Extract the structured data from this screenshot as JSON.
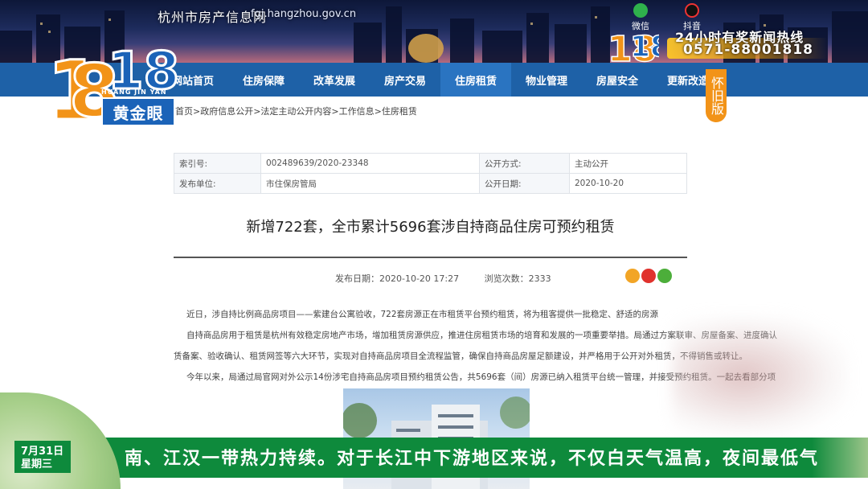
{
  "header": {
    "site_title": "杭州市房产信息网",
    "site_domain": "fgj.hangzhou.gov.cn",
    "social": [
      {
        "label": "微信",
        "icon": "wechat-icon"
      },
      {
        "label": "抖音",
        "icon": "douyin-icon"
      }
    ]
  },
  "overlay": {
    "logo_number": "1818",
    "logo_pinyin": "HUANG JIN YAN",
    "logo_tag": "黄金眼",
    "hotline_title": "24小时有奖新闻热线",
    "hotline_phone": "0571-88001818"
  },
  "nav": {
    "items": [
      "网站首页",
      "住房保障",
      "改革发展",
      "房产交易",
      "住房租赁",
      "物业管理",
      "房屋安全",
      "更新改造"
    ],
    "active_index": 4,
    "old_version": "怀旧版"
  },
  "breadcrumb": "首页>政府信息公开>法定主动公开内容>工作信息>住房租赁",
  "info_table": {
    "rows": [
      {
        "k1": "索引号:",
        "v1": "002489639/2020-23348",
        "k2": "公开方式:",
        "v2": "主动公开"
      },
      {
        "k1": "发布单位:",
        "v1": "市住保房管局",
        "k2": "公开日期:",
        "v2": "2020-10-20"
      }
    ]
  },
  "article": {
    "title": "新增722套，全市累计5696套涉自持商品住房可预约租赁",
    "publish_date": "发布日期：2020-10-20 17:27",
    "views": "浏览次数：2333",
    "paragraphs": [
      "近日，涉自持比例商品房项目——紫建台公寓验收，722套房源正在市租赁平台预约租赁，将为租客提供一批稳定、舒适的房源",
      "自持商品房用于租赁是杭州有效稳定房地产市场，增加租赁房源供应，推进住房租赁市场的培育和发展的一项重要举措。局通过方案联审、房屋备案、进度确认",
      "赁备案、验收确认、租赁网签等六大环节，实现对自持商品房项目全流程监管，确保自持商品房屋足额建设，并严格用于公开对外租赁，不得销售或转让。",
      "今年以来，局通过局官网对外公示14份涉宅自持商品房项目预约租赁公告，共5696套（间）房源已纳入租赁平台统一管理，并接受预约租赁。一起去看部分项"
    ]
  },
  "ticker": {
    "date": "7月31日",
    "weekday": "星期三",
    "text": "南、江汉一带热力持续。对于长江中下游地区来说，不仅白天气温高，夜间最低气"
  },
  "colors": {
    "nav_blue": "#1e61a7",
    "ticker_green": "#0e8a3c",
    "hotline_orange": "#f29318"
  }
}
